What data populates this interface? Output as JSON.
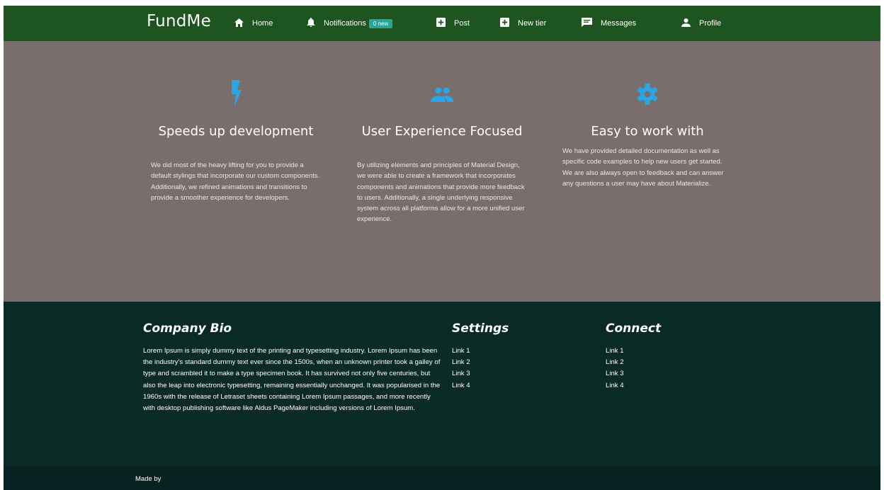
{
  "nav": {
    "brand": "FundMe",
    "items": [
      {
        "label": "Home",
        "icon": "home-icon"
      },
      {
        "label": "Notifications",
        "icon": "bell-icon",
        "badge": "0 new"
      },
      {
        "label": "Post",
        "icon": "add-box-icon"
      },
      {
        "label": "New tier",
        "icon": "add-box-icon"
      },
      {
        "label": "Messages",
        "icon": "message-icon"
      },
      {
        "label": "Profile",
        "icon": "person-icon"
      }
    ]
  },
  "features": [
    {
      "icon": "flash-icon",
      "title": "Speeds up development",
      "text": "We did most of the heavy lifting for you to provide a default stylings that incorporate our custom components. Additionally, we refined animations and transitions to provide a smoother experience for developers."
    },
    {
      "icon": "group-icon",
      "title": "User Experience Focused",
      "text": "By utilizing elements and principles of Material Design, we were able to create a framework that incorporates components and animations that provide more feedback to users. Additionally, a single underlying responsive system across all platforms allow for a more unified user experience."
    },
    {
      "icon": "settings-icon",
      "title": "Easy to work with",
      "text": "We have provided detailed documentation as well as specific code examples to help new users get started. We are also always open to feedback and can answer any questions a user may have about Materialize."
    }
  ],
  "footer": {
    "bio_title": "Company Bio",
    "bio_text": "Lorem Ipsum is simply dummy text of the printing and typesetting industry. Lorem Ipsum has been the industry's standard dummy text ever since the 1500s, when an unknown printer took a galley of type and scrambled it to make a type specimen book. It has survived not only five centuries, but also the leap into electronic typesetting, remaining essentially unchanged. It was popularised in the 1960s with the release of Letraset sheets containing Lorem Ipsum passages, and more recently with desktop publishing software like Aldus PageMaker including versions of Lorem Ipsum.",
    "settings_title": "Settings",
    "settings_links": [
      "Link 1",
      "Link 2",
      "Link 3",
      "Link 4"
    ],
    "connect_title": "Connect",
    "connect_links": [
      "Link 1",
      "Link 2",
      "Link 3",
      "Link 4"
    ],
    "made_by": "Made by"
  },
  "colors": {
    "navbar": "#1e5420",
    "features_bg": "#7a6e6c",
    "accent_icon": "#29a6e6",
    "badge": "#26a69a",
    "footer_bg": "#0a2a25",
    "footer_bottom": "#082221"
  }
}
